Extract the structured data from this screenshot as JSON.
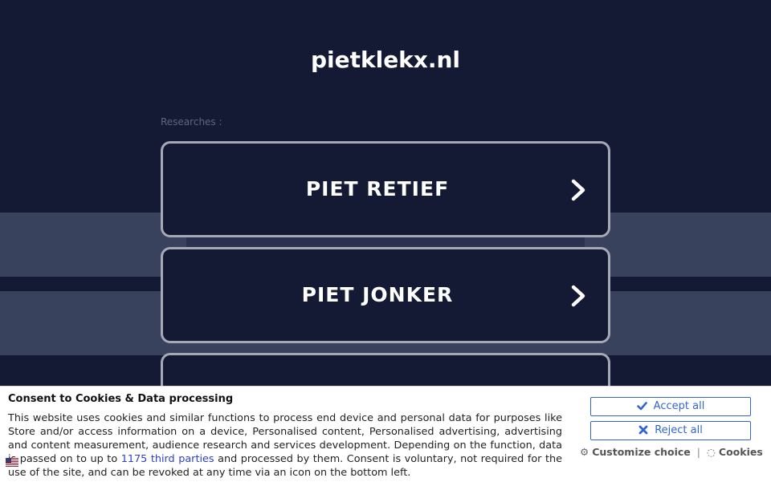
{
  "site": {
    "title": "pietklekx.nl"
  },
  "researches_label": "Researches :",
  "cards": [
    {
      "label": "PIET RETIEF"
    },
    {
      "label": "PIET JONKER"
    },
    {
      "label": ""
    }
  ],
  "consent": {
    "title": "Consent to Cookies & Data processing",
    "text_before_link": "This website uses cookies and similar functions to process end device and personal data for purposes like Store and/or access information on a device, Personalised content, Personalised advertising, advertising and content measurement, audience research and services development. Depending on the function, data is passed on to up to ",
    "link_text": "1175 third parties",
    "text_after_link": " and processed by them. Consent is voluntary, not required for the use of the site, and can be revoked at any time via an icon on the bottom left.",
    "accept_label": "Accept all",
    "reject_label": "Reject all",
    "customize_label": "Customize choice",
    "separator": "|",
    "cookies_label": "Cookies"
  },
  "colors": {
    "background": "#141a33",
    "card_border": "#a6a9b5",
    "button_blue": "#3366cc",
    "link_blue": "#2a3ed0"
  }
}
